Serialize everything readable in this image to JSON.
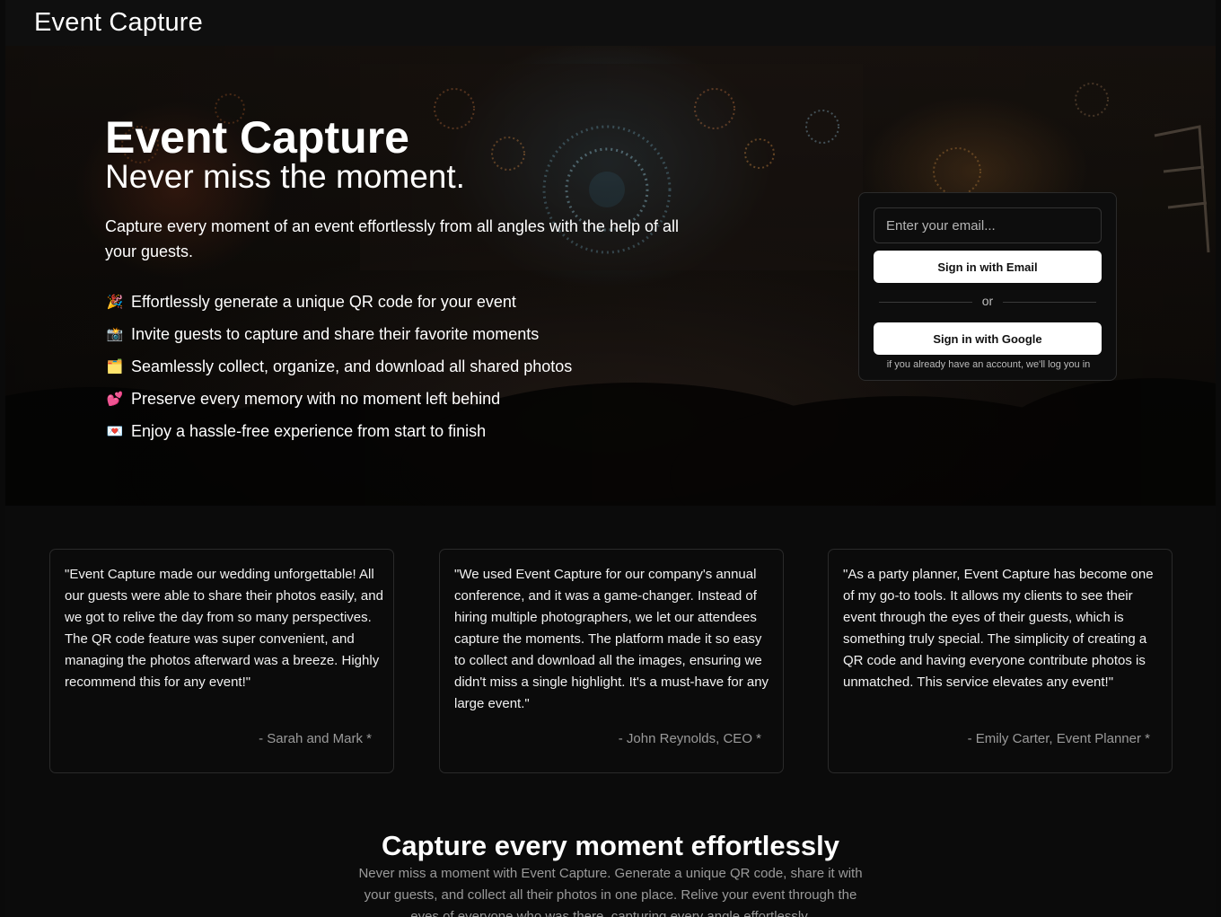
{
  "nav": {
    "brand": "Event Capture"
  },
  "hero": {
    "title": "Event Capture",
    "subtitle": "Never miss the moment.",
    "description": "Capture every moment of an event effortlessly from all angles with the help of all your guests.",
    "features": [
      {
        "emoji": "🎉",
        "icon": "party-popper-icon",
        "text": "Effortlessly generate a unique QR code for your event"
      },
      {
        "emoji": "📸",
        "icon": "camera-icon",
        "text": "Invite guests to capture and share their favorite moments"
      },
      {
        "emoji": "🗂️",
        "icon": "folder-icon",
        "text": "Seamlessly collect, organize, and download all shared photos"
      },
      {
        "emoji": "💕",
        "icon": "two-hearts-icon",
        "text": "Preserve every memory with no moment left behind"
      },
      {
        "emoji": "💌",
        "icon": "love-letter-icon",
        "text": "Enjoy a hassle-free experience from start to finish"
      }
    ]
  },
  "signin": {
    "email_placeholder": "Enter your email...",
    "email_button": "Sign in with Email",
    "or": "or",
    "google_button": "Sign in with Google",
    "hint": "if you already have an account, we'll log you in"
  },
  "testimonials": [
    {
      "quote": "\"Event Capture made our wedding unforgettable! All our guests were able to share their photos easily, and we got to relive the day from so many perspectives. The QR code feature was super convenient, and managing the photos afterward was a breeze. Highly recommend this for any event!\"",
      "author": "- Sarah and Mark *"
    },
    {
      "quote": "\"We used Event Capture for our company's annual conference, and it was a game-changer. Instead of hiring multiple photographers, we let our attendees capture the moments. The platform made it so easy to collect and download all the images, ensuring we didn't miss a single highlight. It's a must-have for any large event.\"",
      "author": "- John Reynolds, CEO *"
    },
    {
      "quote": "\"As a party planner, Event Capture has become one of my go-to tools. It allows my clients to see their event through the eyes of their guests, which is something truly special. The simplicity of creating a QR code and having everyone contribute photos is unmatched. This service elevates any event!\"",
      "author": "- Emily Carter, Event Planner *"
    }
  ],
  "cta": {
    "title": "Capture every moment effortlessly",
    "text": "Never miss a moment with Event Capture. Generate a unique QR code, share it with your guests, and collect all their photos in one place. Relive your event through the eyes of everyone who was there, capturing every angle effortlessly."
  }
}
